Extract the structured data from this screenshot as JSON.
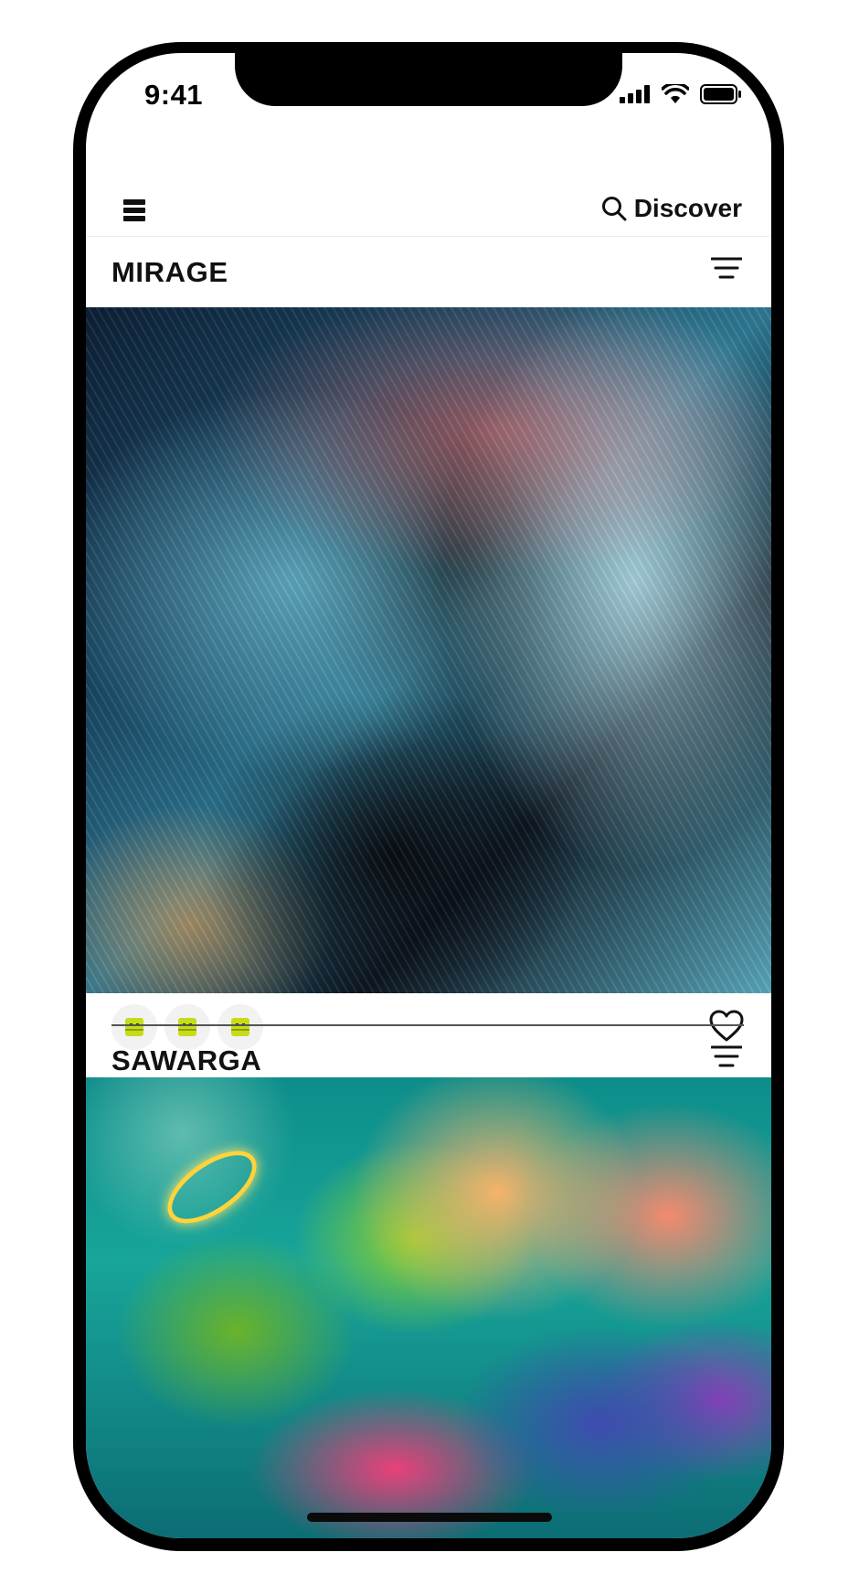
{
  "status_bar": {
    "time": "9:41"
  },
  "top_bar": {
    "discover_label": "Discover",
    "menu_icon": "hamburger-icon",
    "search_icon": "search-icon"
  },
  "feed": [
    {
      "title": "MIRAGE",
      "artwork": "abstract-iridescent-waves",
      "collectors": [
        "avatar-1",
        "avatar-2",
        "avatar-3"
      ],
      "like_icon": "heart-icon"
    },
    {
      "title": "SAWARGA",
      "artwork": "psychedelic-skull-forest-illustration"
    }
  ],
  "colors": {
    "background": "#ffffff",
    "text": "#111111",
    "avatar_accent": "#c6dc18",
    "avatar_bg": "#f2f2f2",
    "divider": "#555555"
  }
}
